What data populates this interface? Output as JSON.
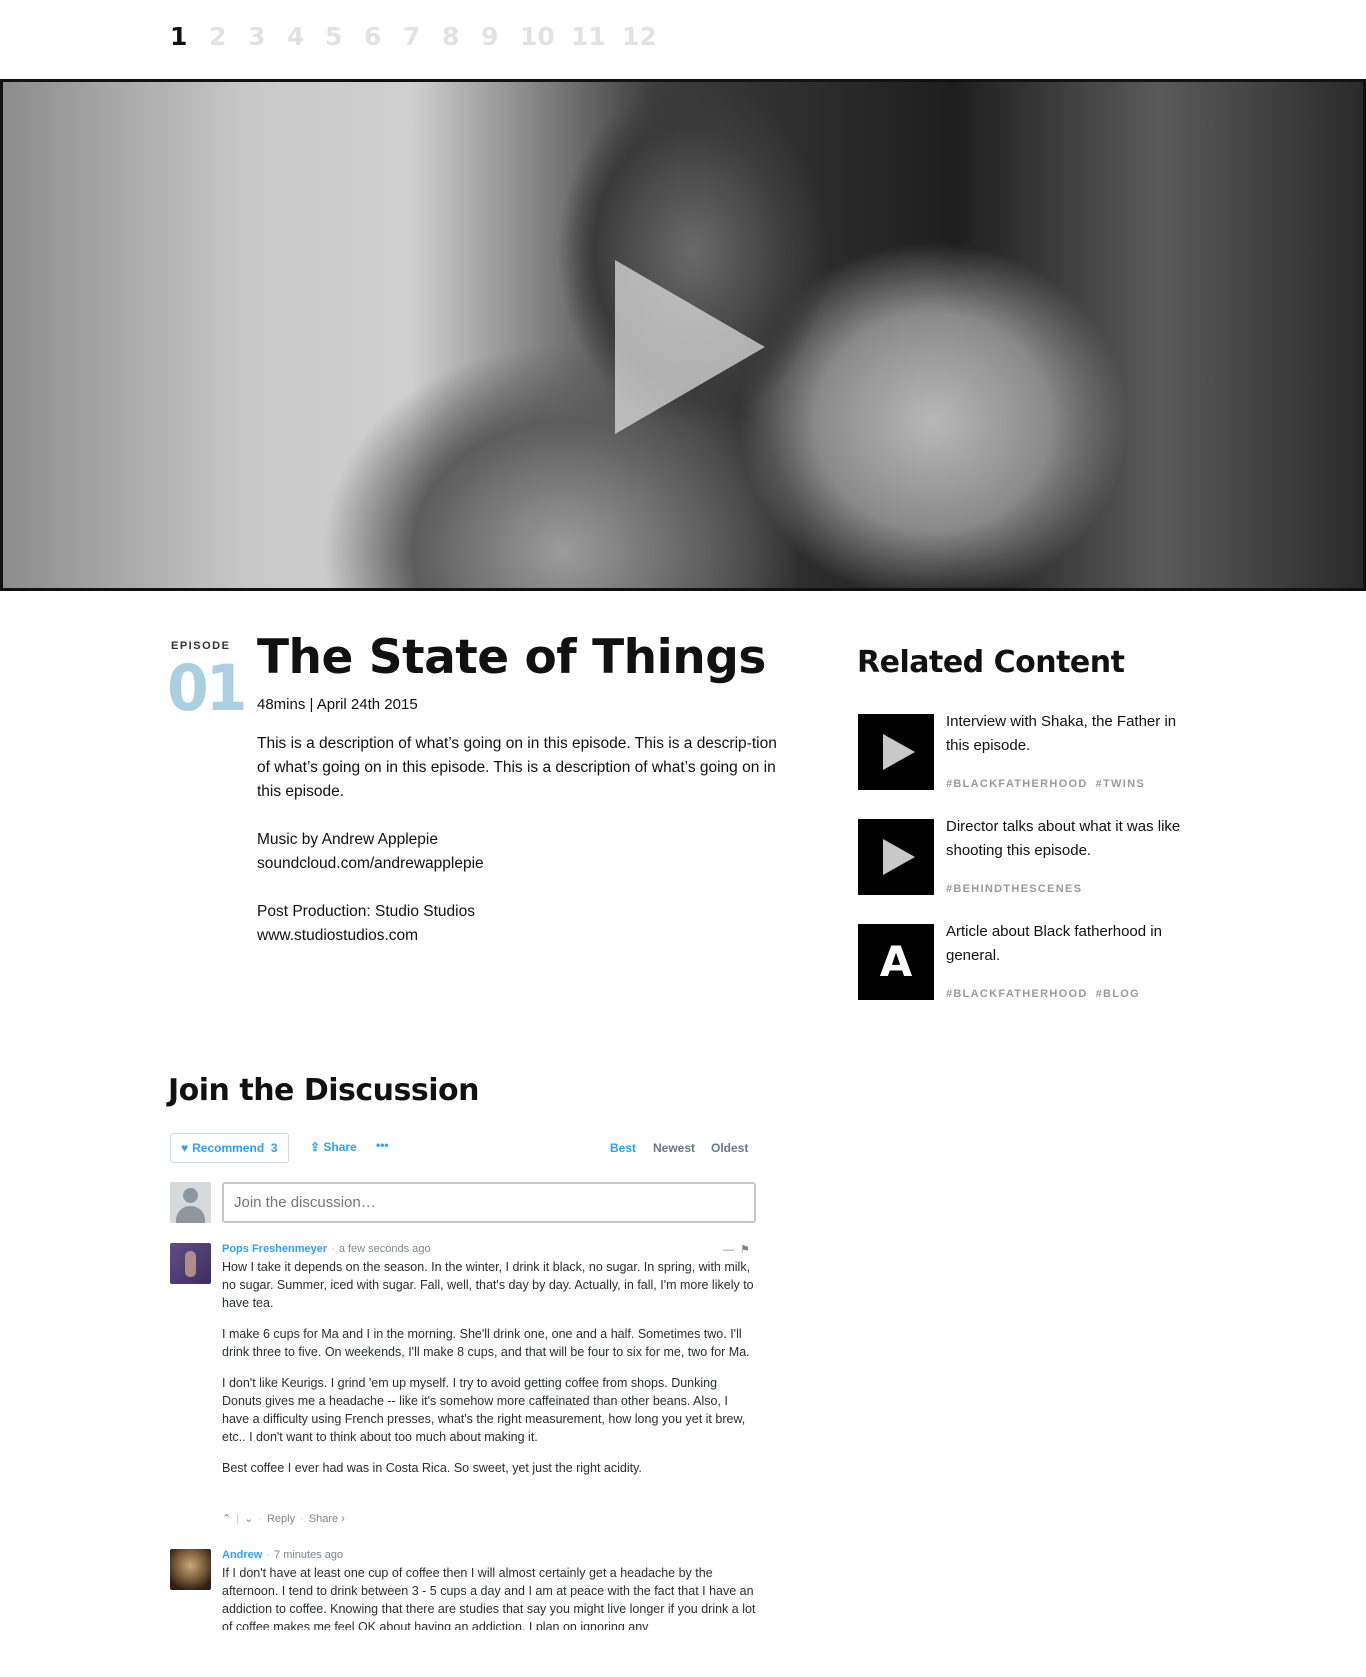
{
  "episode_nav": [
    "1",
    "2",
    "3",
    "4",
    "5",
    "6",
    "7",
    "8",
    "9",
    "10",
    "11",
    "12"
  ],
  "episode": {
    "label": "EPISODE",
    "number": "01",
    "title": "The State of Things",
    "meta": "48mins | April 24th 2015",
    "description": "This is a description of what’s going on in this episode. This is a descrip-tion of what’s going on in this episode. This is a description of what’s going on in this episode.",
    "music_line1": "Music by Andrew Applepie",
    "music_line2": "soundcloud.com/andrewapplepie",
    "post_line1": "Post Production: Studio Studios",
    "post_line2": "www.studiostudios.com"
  },
  "related": {
    "title": "Related Content",
    "items": [
      {
        "text": "Interview with Shaka, the Father in this episode.",
        "tags": [
          "#BLACKFATHERHOOD",
          "#TWINS"
        ],
        "thumb": "play-icon"
      },
      {
        "text": "Director talks about what it was like shooting this episode.",
        "tags": [
          "#BEHINDTHESCENES"
        ],
        "thumb": "play-icon"
      },
      {
        "text": "Article about Black fatherhood in general.",
        "tags": [
          "#BLACKFATHERHOOD",
          "#BLOG"
        ],
        "thumb": "A"
      }
    ]
  },
  "discussion": {
    "title": "Join the Discussion",
    "recommend_label": "Recommend",
    "recommend_count": "3",
    "share_label": "Share",
    "more_label": "•••",
    "sort": [
      "Best",
      "Newest",
      "Oldest"
    ],
    "input_placeholder": "Join the discussion…",
    "comments": [
      {
        "author": "Pops Freshenmeyer",
        "time": "a few seconds ago",
        "paragraphs": [
          "How I take it depends on the season. In the winter, I drink it black, no sugar. In spring, with milk, no sugar. Summer, iced with sugar. Fall, well, that's day by day. Actually, in fall, I'm more likely to have tea.",
          "I make 6 cups for Ma and I in the morning. She'll drink one, one and a half. Sometimes two. I'll drink three to five. On weekends, I'll make 8 cups, and that will be four to six for me, two for Ma.",
          "I don't like Keurigs. I grind 'em up myself. I try to avoid getting coffee from shops. Dunking Donuts gives me a headache -- like it's somehow more caffeinated than other beans. Also, I have a difficulty using French presses, what's the right measurement, how long you yet it brew, etc.. I don't want to think about too much about making it.",
          "Best coffee I ever had was in Costa Rica. So sweet, yet just the right acidity."
        ],
        "reply": "Reply",
        "share": "Share ›"
      },
      {
        "author": "Andrew",
        "time": "7 minutes ago",
        "paragraphs": [
          "If I don't have at least one cup of coffee then I will almost certainly get a headache by the afternoon. I tend to drink between 3 - 5 cups a day and I am at peace with the fact that I have an addiction to coffee. Knowing that there are studies that say you might live longer if you drink a lot of coffee makes me feel OK about having an addiction. I plan on ignoring any"
        ]
      }
    ]
  },
  "colors": {
    "accent_blue": "#2e9fff",
    "episode_number": "#a9cfe0",
    "tag_gray": "#9a9a9a"
  }
}
